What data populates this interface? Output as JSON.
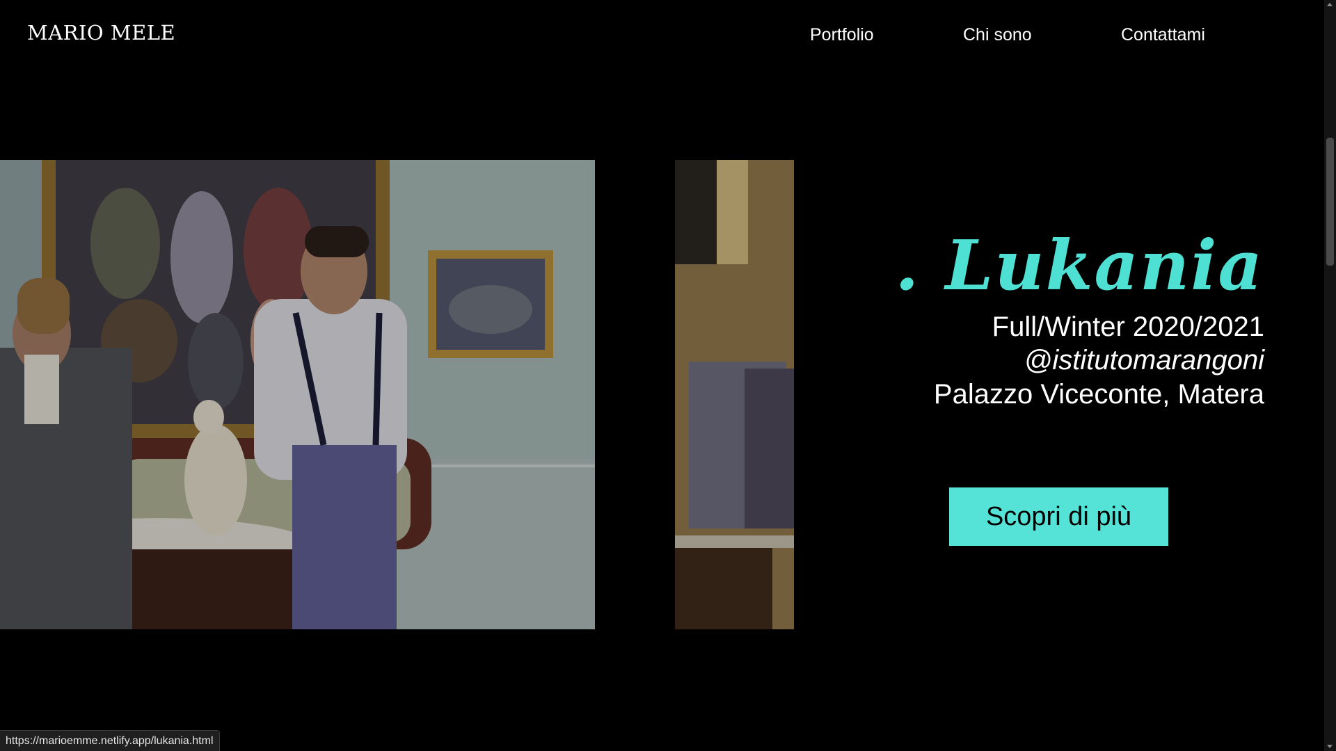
{
  "header": {
    "logo": "MARIO MELE",
    "nav": [
      {
        "label": "Portfolio"
      },
      {
        "label": "Chi sono"
      },
      {
        "label": "Contattami"
      }
    ]
  },
  "hero": {
    "title": ". Lukania",
    "lines": [
      "Full/Winter 2020/2021",
      "@istitutomarangoni",
      "Palazzo Viceconte, Matera"
    ],
    "cta_label": "Scopri di più"
  },
  "status_bar": {
    "url": "https://marioemme.netlify.app/lukania.html"
  },
  "colors": {
    "accent": "#54e3d6",
    "background": "#000000"
  }
}
